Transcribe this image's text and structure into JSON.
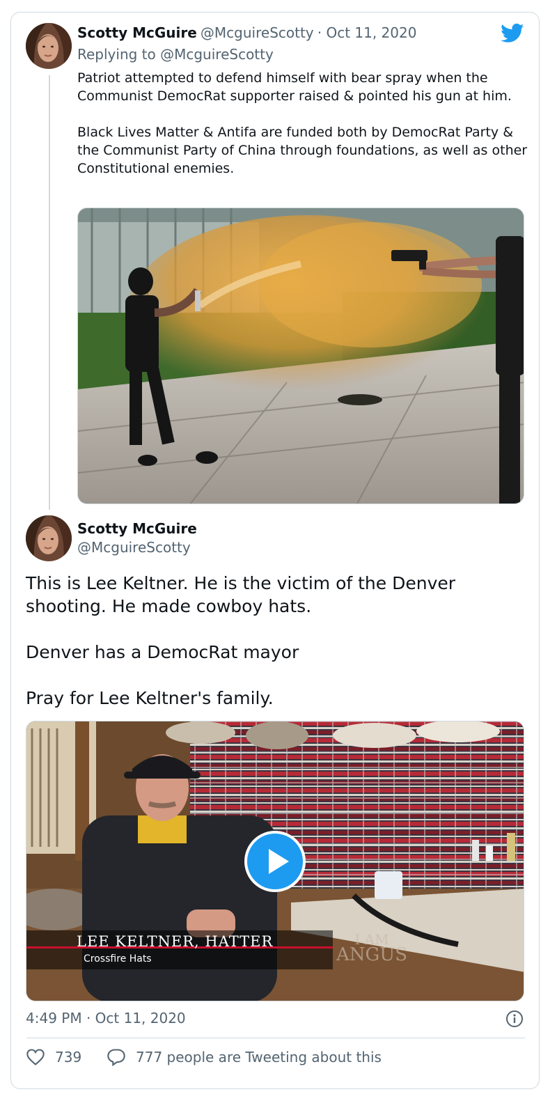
{
  "reply_tweet": {
    "name": "Scotty McGuire",
    "handle": "@McguireScotty",
    "date": "· Oct 11, 2020",
    "replying_to": "Replying to @McguireScotty",
    "text": "Patriot attempted to defend himself with bear spray when the Communist DemocRat supporter raised & pointed his gun at him.\n\nBlack Lives Matter & Antifa are funded both by DemocRat Party & the Communist Party of China through foundations, as well as other Constitutional enemies."
  },
  "main_tweet": {
    "name": "Scotty McGuire",
    "handle": "@McguireScotty",
    "text": "This is Lee Keltner. He is the victim of the Denver shooting. He made cowboy hats.\n\nDenver has a DemocRat mayor\n\n Pray for Lee Keltner's family.",
    "video": {
      "caption_title": "LEE KELTNER, HATTER",
      "caption_subtitle": "Crossfire Hats",
      "watermark_line1": "I AM",
      "watermark_line2": "ANGUS"
    },
    "timestamp": "4:49 PM · Oct 11, 2020",
    "likes": "739",
    "conversation": "777 people are Tweeting about this"
  },
  "colors": {
    "brand": "#1d9bf0",
    "text": "#0f1419",
    "muted": "#536471",
    "border": "#cfd9de"
  },
  "icons": [
    "twitter-bird-icon",
    "heart-icon",
    "comment-icon",
    "info-icon",
    "play-icon"
  ]
}
